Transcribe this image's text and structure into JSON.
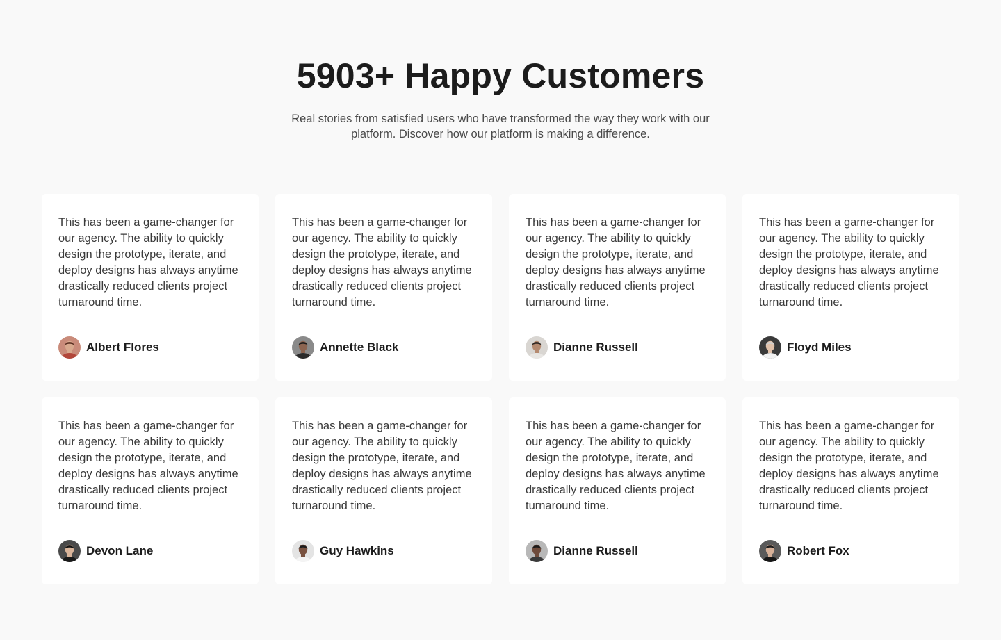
{
  "header": {
    "title": "5903+ Happy Customers",
    "subtitle": "Real stories from satisfied users who have transformed the way they work with our platform. Discover how our platform is making a difference."
  },
  "testimonials": [
    {
      "quote": "This has been a game-changer for our agency. The ability to quickly design the prototype, iterate, and deploy designs has always anytime drastically reduced clients project turnaround time.",
      "name": "Albert Flores",
      "avatar": {
        "bg": "#c98b7a",
        "skin": "#d8a98e",
        "hair": "#5a2f22",
        "shirt": "#b2463a"
      }
    },
    {
      "quote": "This has been a game-changer for our agency. The ability to quickly design the prototype, iterate, and deploy designs has always anytime drastically reduced clients project turnaround time.",
      "name": "Annette Black",
      "avatar": {
        "bg": "#8a8a8a",
        "skin": "#8c6450",
        "hair": "#1c1c1c",
        "shirt": "#2a2a2a"
      }
    },
    {
      "quote": "This has been a game-changer for our agency. The ability to quickly design the prototype, iterate, and deploy designs has always anytime drastically reduced clients project turnaround time.",
      "name": "Dianne Russell",
      "avatar": {
        "bg": "#d9d6d2",
        "skin": "#b58a70",
        "hair": "#2b2420",
        "shirt": "#e8e6e3"
      }
    },
    {
      "quote": "This has been a game-changer for our agency. The ability to quickly design the prototype, iterate, and deploy designs has always anytime drastically reduced clients project turnaround time.",
      "name": "Floyd Miles",
      "avatar": {
        "bg": "#3a3a3a",
        "skin": "#e0c1aa",
        "hair": "#cfcfcf",
        "shirt": "#f2f2f2"
      }
    },
    {
      "quote": "This has been a game-changer for our agency. The ability to quickly design the prototype, iterate, and deploy designs has always anytime drastically reduced clients project turnaround time.",
      "name": "Devon Lane",
      "avatar": {
        "bg": "#4a4a4a",
        "skin": "#d9b49a",
        "hair": "#141414",
        "shirt": "#1a1a1a"
      }
    },
    {
      "quote": "This has been a game-changer for our agency. The ability to quickly design the prototype, iterate, and deploy designs has always anytime drastically reduced clients project turnaround time.",
      "name": "Guy Hawkins",
      "avatar": {
        "bg": "#e4e4e4",
        "skin": "#7a5240",
        "hair": "#1c1c1c",
        "shirt": "#f4f4f4"
      }
    },
    {
      "quote": "This has been a game-changer for our agency. The ability to quickly design the prototype, iterate, and deploy designs has always anytime drastically reduced clients project turnaround time.",
      "name": "Dianne Russell",
      "avatar": {
        "bg": "#b8b8b8",
        "skin": "#6e4a3a",
        "hair": "#1a1a1a",
        "shirt": "#3a3a3a"
      }
    },
    {
      "quote": "This has been a game-changer for our agency. The ability to quickly design the prototype, iterate, and deploy designs has always anytime drastically reduced clients project turnaround time.",
      "name": "Robert Fox",
      "avatar": {
        "bg": "#5a5a5a",
        "skin": "#d6b098",
        "hair": "#1e1e1e",
        "shirt": "#161616"
      }
    }
  ]
}
